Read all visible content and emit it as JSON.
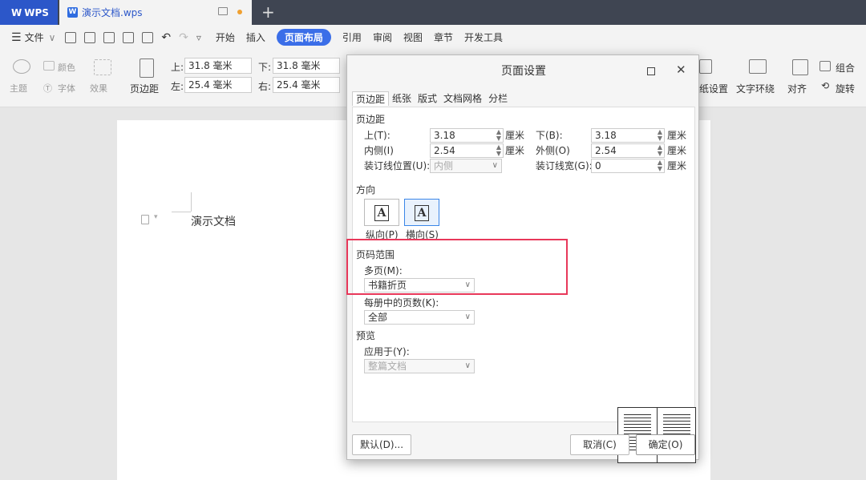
{
  "titlebar": {
    "app_tab": "WPS",
    "app_logo": "W",
    "doc_tab": "演示文档.wps",
    "doc_icon": "W"
  },
  "menubar": {
    "file": "文件",
    "items": [
      "开始",
      "插入",
      "页面布局",
      "引用",
      "审阅",
      "视图",
      "章节",
      "开发工具"
    ],
    "active": "页面布局"
  },
  "ribbon": {
    "theme": "主题",
    "color": "颜色",
    "font": "字体",
    "effect": "效果",
    "margins": "页边距",
    "top_label": "上:",
    "top_value": "31.8 毫米",
    "bottom_label": "下:",
    "bottom_value": "31.8 毫米",
    "left_label": "左:",
    "left_value": "25.4 毫米",
    "right_label": "右:",
    "right_value": "25.4 毫米",
    "paper_settings": "纸设置",
    "wrap_text": "文字环绕",
    "align": "对齐",
    "group": "组合",
    "rotate": "旋转"
  },
  "document": {
    "text": "演示文档"
  },
  "dialog": {
    "title": "页面设置",
    "tabs": [
      "页边距",
      "纸张",
      "版式",
      "文档网格",
      "分栏"
    ],
    "margins_section": "页边距",
    "top_label": "上(T):",
    "top_value": "3.18",
    "top_unit": "厘米",
    "bottom_label": "下(B):",
    "bottom_value": "3.18",
    "bottom_unit": "厘米",
    "inner_label": "内侧(I)",
    "inner_value": "2.54",
    "inner_unit": "厘米",
    "outer_label": "外侧(O)",
    "outer_value": "2.54",
    "outer_unit": "厘米",
    "gutter_pos_label": "装订线位置(U):",
    "gutter_pos_value": "内侧",
    "gutter_width_label": "装订线宽(G):",
    "gutter_width_value": "0",
    "gutter_width_unit": "厘米",
    "orientation_section": "方向",
    "portrait": "纵向(P)",
    "landscape": "横向(S)",
    "page_range_section": "页码范围",
    "multi_page_label": "多页(M):",
    "multi_page_value": "书籍折页",
    "pages_per_booklet_label": "每册中的页数(K):",
    "pages_per_booklet_value": "全部",
    "preview_section": "预览",
    "apply_to_label": "应用于(Y):",
    "apply_to_value": "整篇文档",
    "default_button": "默认(D)...",
    "cancel_button": "取消(C)",
    "ok_button": "确定(O)"
  },
  "colors": {
    "accent": "#3b6ee8",
    "highlight_box": "#e8385a"
  }
}
